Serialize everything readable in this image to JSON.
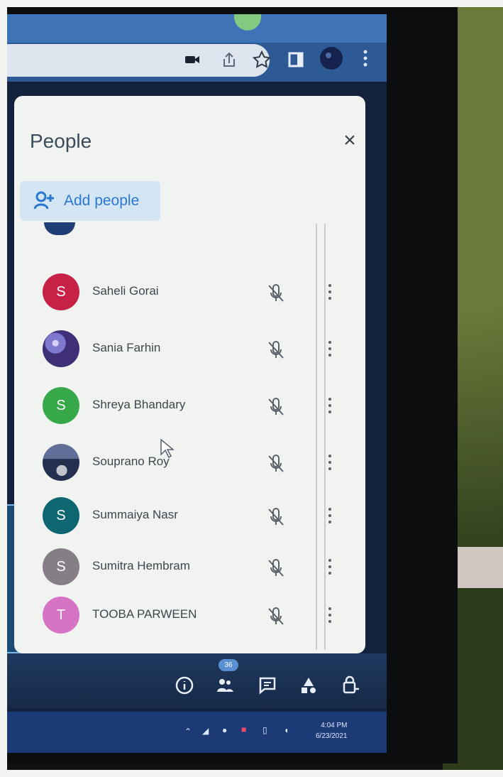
{
  "panel": {
    "title": "People",
    "add_people_label": "Add people"
  },
  "participants": [
    {
      "name": "Saheli Gorai",
      "avatar_text": "S",
      "avatar_color": "#c72246"
    },
    {
      "name": "Sania Farhin",
      "avatar_text": "",
      "avatar_color": "#5a57b7"
    },
    {
      "name": "Shreya Bhandary",
      "avatar_text": "S",
      "avatar_color": "#38a94b"
    },
    {
      "name": "Souprano Roy",
      "avatar_text": "",
      "avatar_color": "#50609a"
    },
    {
      "name": "Summaiya Nasr",
      "avatar_text": "S",
      "avatar_color": "#0d6670"
    },
    {
      "name": "Sumitra Hembram",
      "avatar_text": "S",
      "avatar_color": "#857e87"
    },
    {
      "name": "TOOBA PARWEEN",
      "avatar_text": "T",
      "avatar_color": "#d773c4"
    }
  ],
  "toolbar": {
    "people_badge": "36"
  },
  "taskbar": {
    "time": "4:04 PM",
    "date": "6/23/2021"
  }
}
